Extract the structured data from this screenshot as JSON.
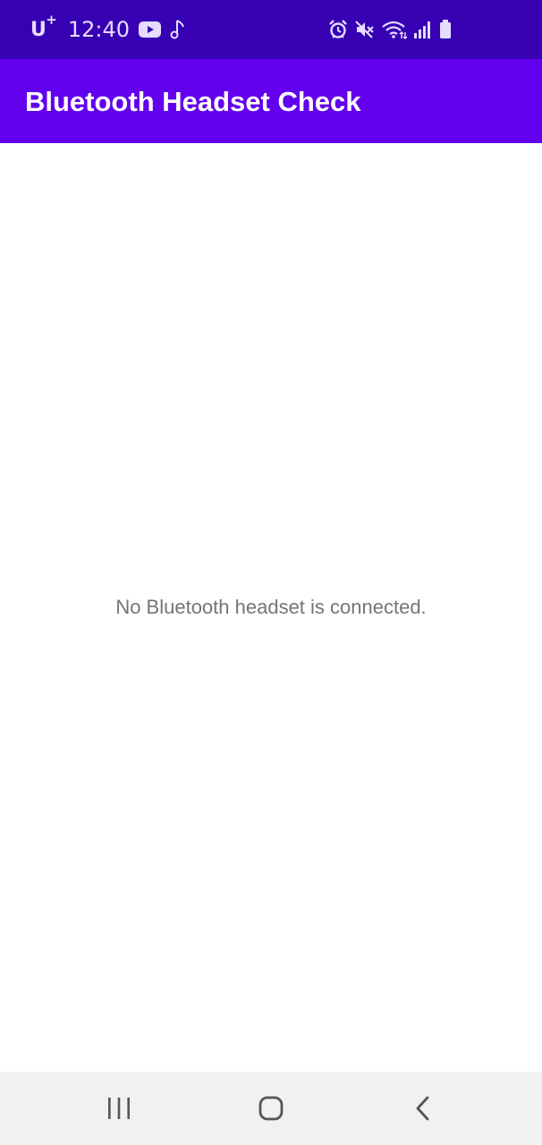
{
  "status_bar": {
    "carrier": "U",
    "carrier_sup": "+",
    "time": "12:40",
    "left_icons": [
      "youtube-icon",
      "music-note-icon"
    ],
    "right_icons": [
      "alarm-icon",
      "mute-icon",
      "wifi-icon",
      "signal-icon",
      "battery-icon"
    ]
  },
  "app_bar": {
    "title": "Bluetooth Headset Check"
  },
  "main": {
    "message": "No Bluetooth headset is connected."
  },
  "nav_bar": {
    "buttons": [
      "recent-apps-icon",
      "home-icon",
      "back-icon"
    ]
  },
  "colors": {
    "status_bar": "#3700B3",
    "app_bar": "#6200EE",
    "message_text": "#757575",
    "nav_bar": "#F1F1F1"
  }
}
